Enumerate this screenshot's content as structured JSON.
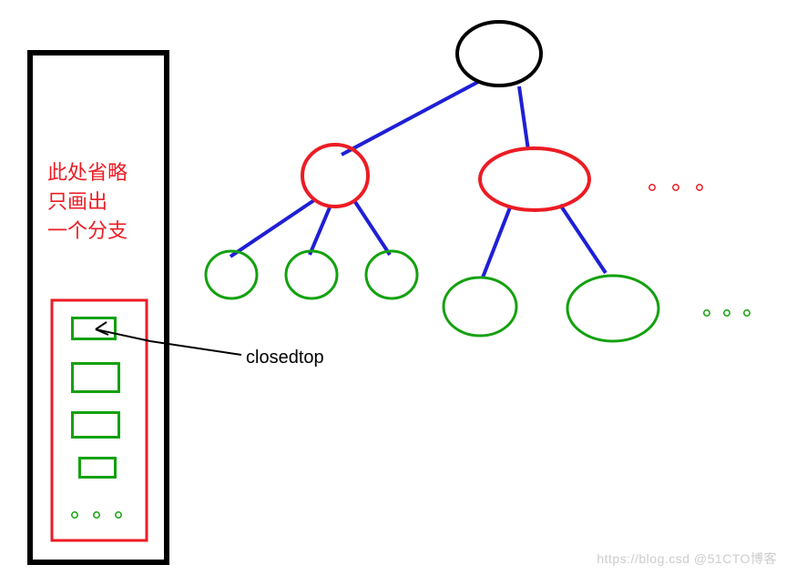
{
  "sidebar": {
    "note_line1": "此处省略",
    "note_line2": "只画出",
    "note_line3": "一个分支"
  },
  "label": {
    "closedtop": "closedtop"
  },
  "ellipsis": {
    "dot": "o"
  },
  "watermark": "https://blog.csd  @51CTO博客",
  "colors": {
    "black": "#000000",
    "red": "#ec1c24",
    "blue": "#1f1fd6",
    "green": "#13a10e"
  },
  "tree": {
    "root": {
      "stroke": "black"
    },
    "level1_left": {
      "stroke": "red"
    },
    "level1_right": {
      "stroke": "red"
    },
    "level2_left_children": 3,
    "level2_right_children": 2,
    "leaf_stroke": "green"
  },
  "stack": {
    "box_count": 4,
    "box_stroke": "green",
    "outline_stroke": "red"
  }
}
